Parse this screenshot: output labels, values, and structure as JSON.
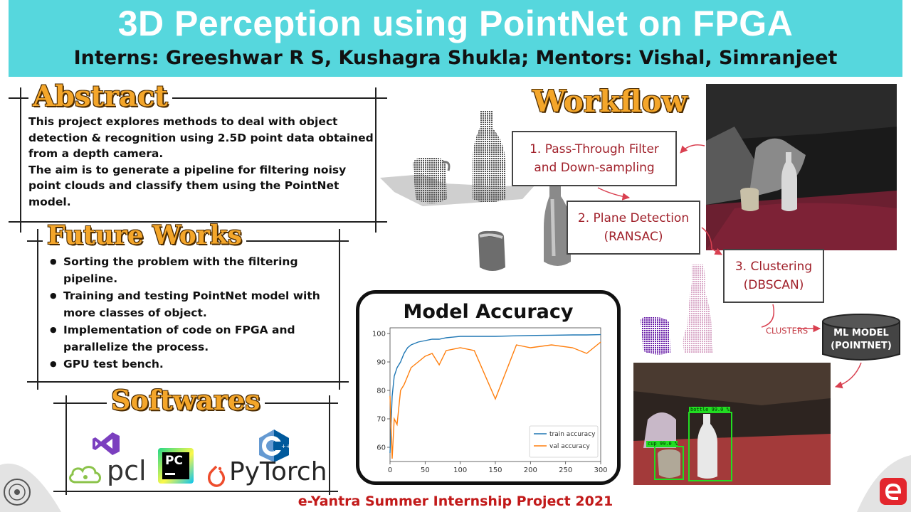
{
  "header": {
    "title": "3D Perception using PointNet on FPGA",
    "subtitle": "Interns: Greeshwar R S, Kushagra Shukla; Mentors: Vishal, Simranjeet"
  },
  "abstract": {
    "heading": "Abstract",
    "paragraph1": "This project explores methods to deal with object detection & recognition using 2.5D point data obtained from a depth camera.",
    "paragraph2": "The aim is to generate a pipeline for filtering noisy point clouds and classify them using the PointNet model."
  },
  "future_works": {
    "heading": "Future Works",
    "items": [
      "Sorting the problem with the filtering pipeline.",
      "Training and testing PointNet model with more classes of object.",
      "Implementation of code on FPGA and parallelize the process.",
      "GPU test bench."
    ]
  },
  "softwares": {
    "heading": "Softwares",
    "logos": [
      "visual-studio-icon",
      "pcl-logo",
      "pycharm-icon",
      "cpp-icon",
      "pytorch-logo"
    ],
    "pcl_text": "pcl",
    "pycharm_text": "PC",
    "cpp_text": "C",
    "pytorch_text": "PyTorch"
  },
  "model_accuracy": {
    "title": "Model Accuracy"
  },
  "workflow": {
    "heading": "Workflow",
    "step1": "1. Pass-Through Filter and Down-sampling",
    "step2": "2. Plane Detection (RANSAC)",
    "step3": "3. Clustering (DBSCAN)",
    "clusters_label": "CLUSTERS",
    "ml_model": "ML MODEL (POINTNET)",
    "detection_label_1": "bottle 99.0 %",
    "detection_label_2": "cup 99.0 %"
  },
  "footer": {
    "text": "e-Yantra Summer Internship Project 2021"
  },
  "colors": {
    "header_bg": "#56d7dd",
    "heading_orange": "#f4a62a",
    "step_text": "#a0202a",
    "footer_red": "#c21a1a",
    "train": "#1f77b4",
    "val": "#ff7f0e"
  },
  "chart_data": {
    "type": "line",
    "title": "Model Accuracy",
    "xlabel": "",
    "ylabel": "",
    "xlim": [
      0,
      300
    ],
    "ylim": [
      55,
      102
    ],
    "xticks": [
      "0",
      "50",
      "100",
      "150",
      "200",
      "250",
      "300"
    ],
    "yticks": [
      "60",
      "70",
      "80",
      "90",
      "100"
    ],
    "legend_position": "bottom-right",
    "series": [
      {
        "name": "train accuracy",
        "color": "#1f77b4",
        "x": [
          0,
          3,
          6,
          10,
          15,
          20,
          25,
          30,
          40,
          50,
          60,
          70,
          80,
          100,
          120,
          150,
          180,
          200,
          230,
          260,
          280,
          300
        ],
        "values": [
          58,
          78,
          85,
          88,
          90,
          93,
          95,
          96,
          97,
          97.5,
          98,
          98,
          98.5,
          99,
          99,
          99,
          99.2,
          99.3,
          99.4,
          99.5,
          99.5,
          99.6
        ]
      },
      {
        "name": "val accuracy",
        "color": "#ff7f0e",
        "x": [
          0,
          3,
          6,
          10,
          15,
          20,
          25,
          30,
          40,
          50,
          60,
          70,
          80,
          100,
          120,
          150,
          180,
          200,
          230,
          260,
          280,
          300
        ],
        "values": [
          78,
          56,
          70,
          68,
          80,
          82,
          85,
          88,
          90,
          92,
          93,
          89,
          94,
          95,
          94,
          77,
          96,
          95,
          96,
          95,
          93,
          97
        ]
      }
    ]
  }
}
